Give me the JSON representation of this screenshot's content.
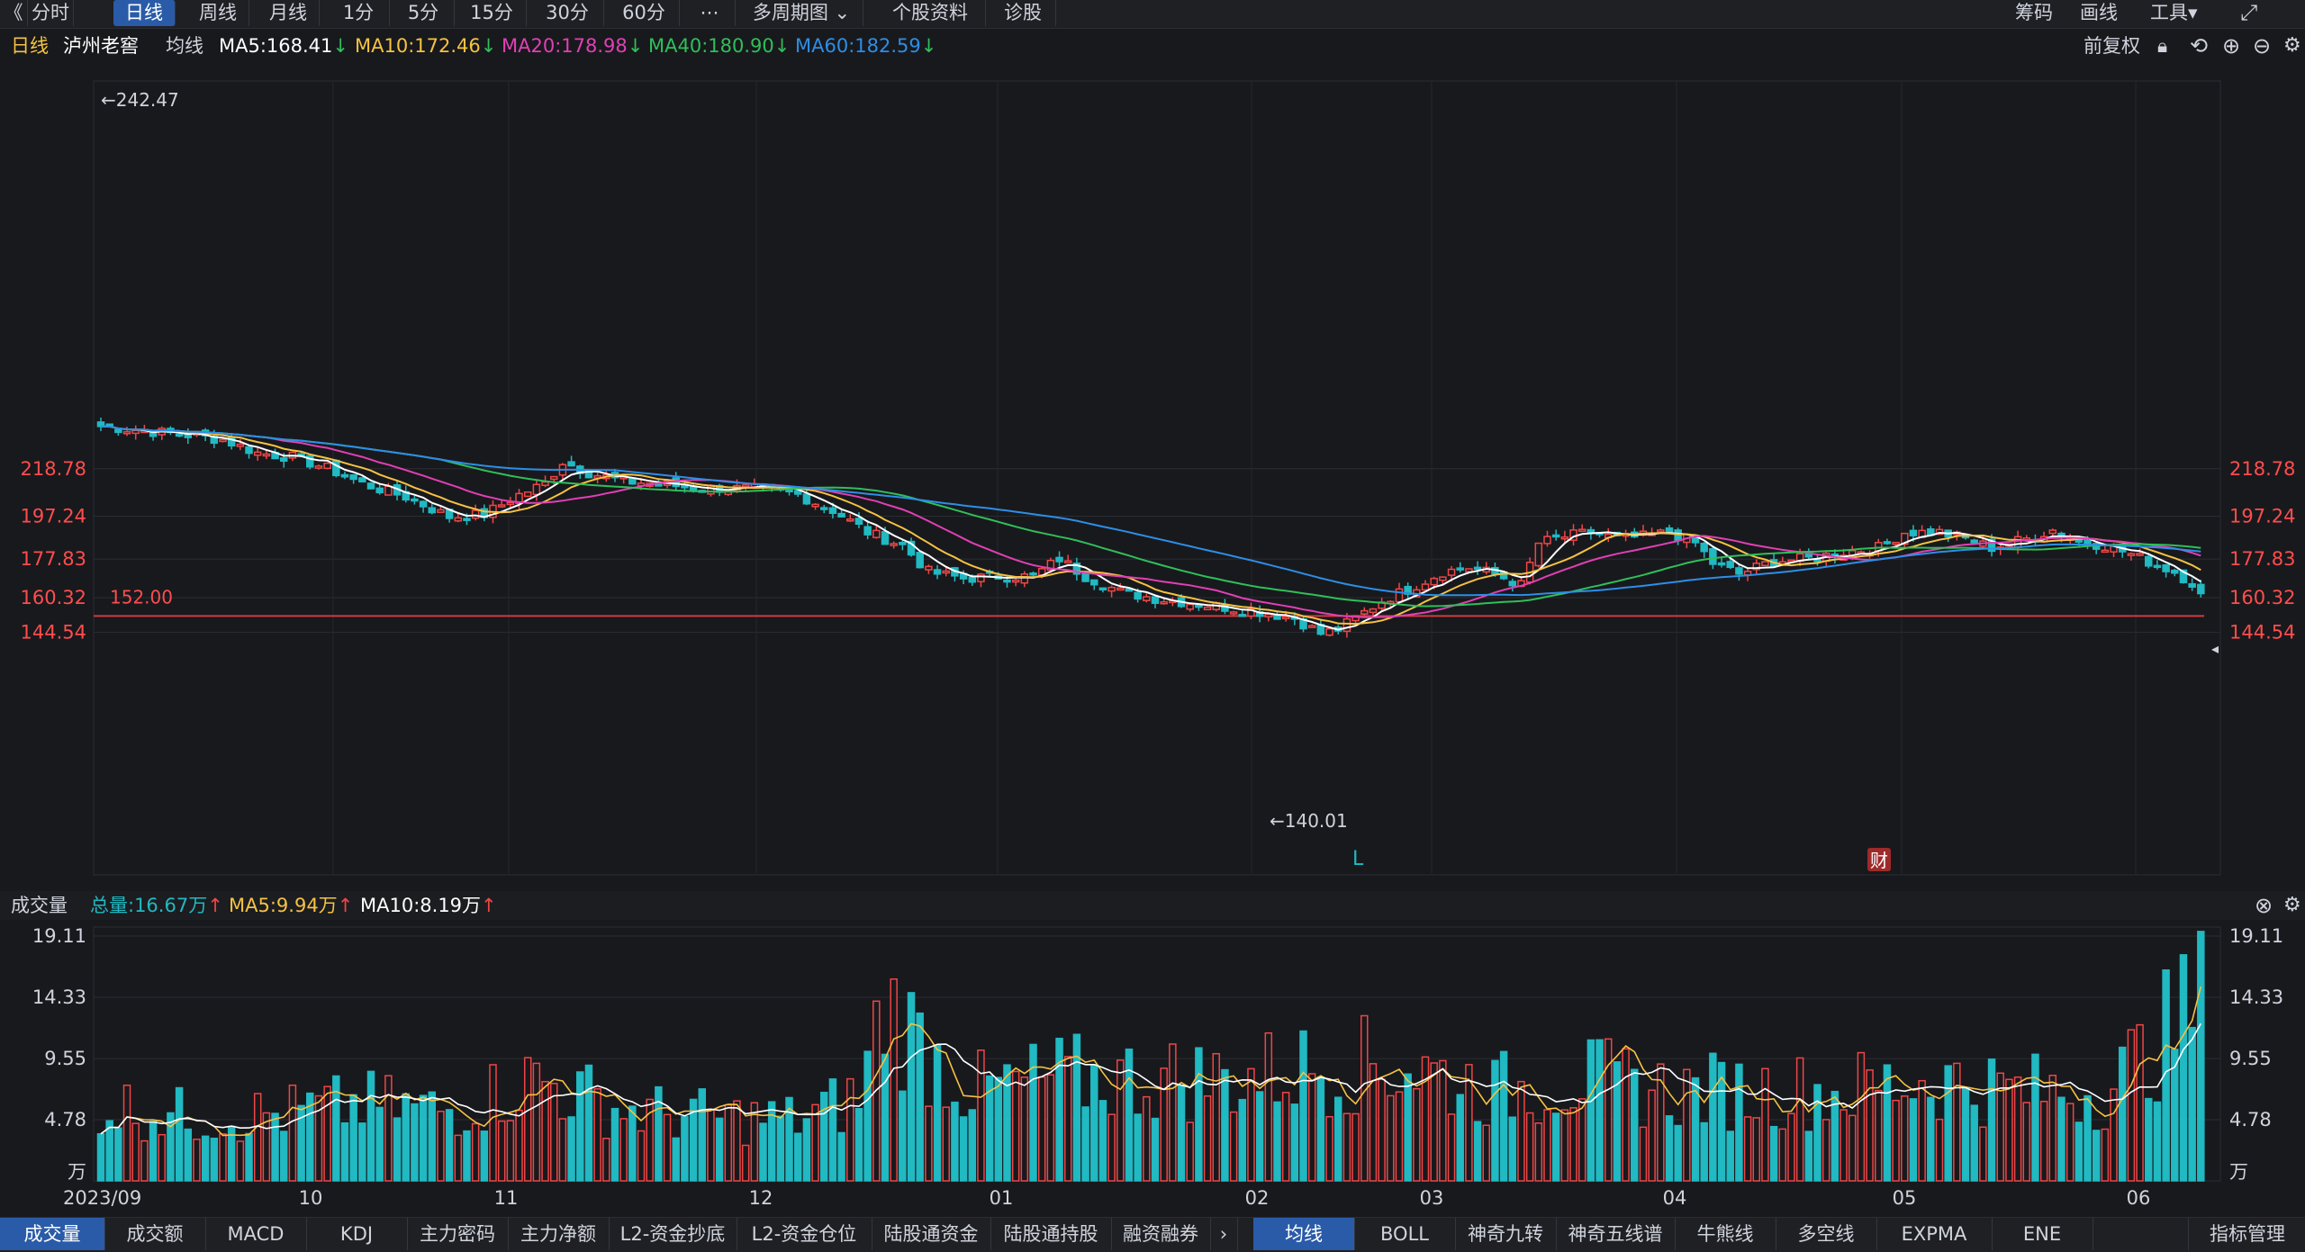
{
  "toolbar": {
    "back_icon": "double-chevron-left-icon",
    "periods": [
      "分时",
      "日线",
      "周线",
      "月线",
      "1分",
      "5分",
      "15分",
      "30分",
      "60分",
      "⋯",
      "多周期图",
      "个股资料",
      "诊股"
    ],
    "active_period": "日线",
    "right": [
      "筹码",
      "画线",
      "工具"
    ]
  },
  "info": {
    "period": "日线",
    "stock_name": "泸州老窖",
    "indicator": "均线",
    "ma5": "MA5:168.41",
    "ma10": "MA10:172.46",
    "ma20": "MA20:178.98",
    "ma40": "MA40:180.90",
    "ma60": "MA60:182.59",
    "adjust": "前复权"
  },
  "volume_header": {
    "title": "成交量",
    "total": "总量:16.67万",
    "ma5": "MA5:9.94万",
    "ma10": "MA10:8.19万"
  },
  "colors": {
    "up": "#ef4646",
    "down": "#21b9c2",
    "ma5": "#ffffff",
    "ma10": "#f5c242",
    "ma20": "#e040b4",
    "ma40": "#2fbf5a",
    "ma60": "#2d8ee6",
    "price_label": "#ff4d4d",
    "ref_line": "#d23a3a"
  },
  "chart_data": {
    "type": "candlestick",
    "price_axis_ticks": [
      "218.78",
      "197.24",
      "177.83",
      "160.32",
      "144.54"
    ],
    "price_axis_values": [
      218.78,
      197.24,
      177.83,
      160.32,
      144.54
    ],
    "high_marker": "←242.47",
    "low_marker": "←140.01",
    "ref_line_label": "152.00",
    "ref_line_value": 152.0,
    "markers": [
      "L",
      "财"
    ],
    "x_ticks": [
      "2023/09",
      "10",
      "11",
      "12",
      "01",
      "02",
      "03",
      "04",
      "05",
      "06"
    ],
    "volume_axis_ticks": [
      "19.11",
      "14.33",
      "9.55",
      "4.78",
      "万"
    ],
    "volume_axis_values": [
      19.11,
      14.33,
      9.55,
      4.78
    ],
    "volume_unit": "万",
    "close_pivots": [
      [
        0,
        238
      ],
      [
        5,
        236
      ],
      [
        10,
        234
      ],
      [
        14,
        232
      ],
      [
        18,
        226
      ],
      [
        22,
        224
      ],
      [
        26,
        219
      ],
      [
        30,
        212
      ],
      [
        35,
        206
      ],
      [
        40,
        197
      ],
      [
        44,
        198
      ],
      [
        48,
        207
      ],
      [
        51,
        212
      ],
      [
        53,
        222
      ],
      [
        56,
        217
      ],
      [
        60,
        213
      ],
      [
        64,
        212
      ],
      [
        68,
        210
      ],
      [
        72,
        210
      ],
      [
        77,
        209
      ],
      [
        80,
        207
      ],
      [
        84,
        200
      ],
      [
        88,
        190
      ],
      [
        92,
        184
      ],
      [
        95,
        172
      ],
      [
        99,
        169
      ],
      [
        103,
        170
      ],
      [
        107,
        170
      ],
      [
        110,
        178
      ],
      [
        113,
        170
      ],
      [
        117,
        163
      ],
      [
        121,
        160
      ],
      [
        125,
        158
      ],
      [
        129,
        156
      ],
      [
        133,
        154
      ],
      [
        137,
        151
      ],
      [
        140,
        144
      ],
      [
        142,
        146
      ],
      [
        144,
        151
      ],
      [
        147,
        159
      ],
      [
        150,
        164
      ],
      [
        154,
        172
      ],
      [
        157,
        174
      ],
      [
        160,
        171
      ],
      [
        163,
        166
      ],
      [
        165,
        185
      ],
      [
        168,
        188
      ],
      [
        171,
        190
      ],
      [
        174,
        187
      ],
      [
        177,
        188
      ],
      [
        180,
        190
      ],
      [
        183,
        185
      ],
      [
        185,
        176
      ],
      [
        188,
        171
      ],
      [
        192,
        177
      ],
      [
        196,
        178
      ],
      [
        200,
        181
      ],
      [
        204,
        183
      ],
      [
        207,
        190
      ],
      [
        211,
        190
      ],
      [
        214,
        187
      ],
      [
        217,
        183
      ],
      [
        221,
        187
      ],
      [
        224,
        191
      ],
      [
        227,
        186
      ],
      [
        230,
        184
      ],
      [
        233,
        180
      ],
      [
        236,
        175
      ],
      [
        238,
        172
      ],
      [
        240,
        167
      ],
      [
        241,
        161
      ]
    ],
    "volume_pivots": [
      [
        0,
        6
      ],
      [
        10,
        5
      ],
      [
        20,
        5.2
      ],
      [
        30,
        6
      ],
      [
        40,
        5.5
      ],
      [
        50,
        8
      ],
      [
        60,
        5.5
      ],
      [
        70,
        5
      ],
      [
        80,
        4.8
      ],
      [
        87,
        6.5
      ],
      [
        90,
        14
      ],
      [
        95,
        10
      ],
      [
        100,
        7
      ],
      [
        110,
        8
      ],
      [
        120,
        8
      ],
      [
        130,
        8
      ],
      [
        140,
        9
      ],
      [
        150,
        9
      ],
      [
        160,
        7
      ],
      [
        170,
        8
      ],
      [
        180,
        7
      ],
      [
        190,
        7
      ],
      [
        200,
        7
      ],
      [
        210,
        8
      ],
      [
        220,
        7
      ],
      [
        230,
        7
      ],
      [
        241,
        14
      ]
    ]
  },
  "bottom": {
    "volume_tabs": [
      "成交量",
      "成交额",
      "MACD",
      "KDJ",
      "主力密码",
      "主力净额",
      "L2-资金抄底",
      "L2-资金仓位",
      "陆股通资金",
      "陆股通持股",
      "融资融券"
    ],
    "active_volume_tab": "成交量",
    "indicator_tabs": [
      "均线",
      "BOLL",
      "神奇九转",
      "神奇五线谱",
      "牛熊线",
      "多空线",
      "EXPMA",
      "ENE"
    ],
    "active_indicator_tab": "均线",
    "manage": "指标管理"
  }
}
